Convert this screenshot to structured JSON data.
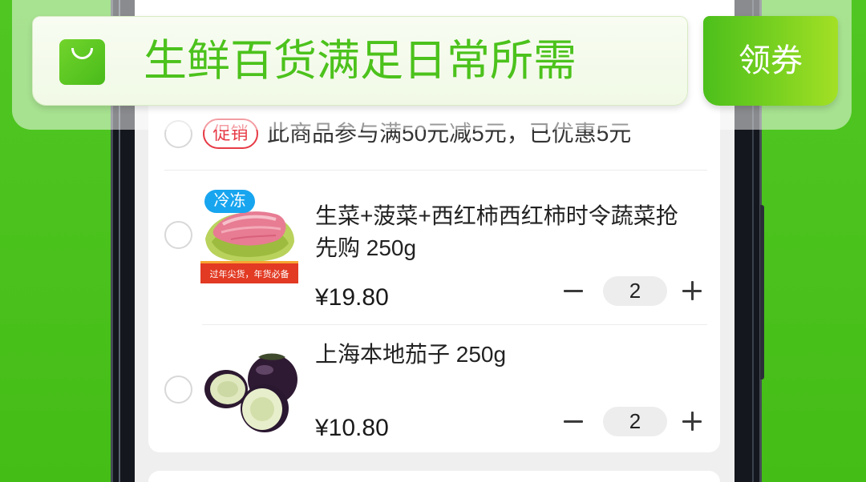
{
  "banner": {
    "icon": "shopping-bag-icon",
    "slogan": "生鲜百货满足日常所需",
    "coupon_label": "领券"
  },
  "cart": {
    "promo": {
      "tag": "促销",
      "text": "此商品参与满50元减5元，已优惠5元"
    },
    "items": [
      {
        "badge": "冷冻",
        "image_caption": "过年尖货，年货必备",
        "title": "生菜+菠菜+西红柿西红柿时令蔬菜抢先购 250g",
        "price": "¥19.80",
        "quantity": "2"
      },
      {
        "title": "上海本地茄子 250g",
        "price": "¥10.80",
        "quantity": "2"
      }
    ]
  },
  "icons": {
    "select": "radio-unchecked-icon",
    "decrease": "minus-icon",
    "increase": "plus-icon"
  },
  "theme": {
    "brand_green": "#4cc21c",
    "promo_red": "#e63b46",
    "cold_badge_blue": "#18a5ef",
    "coupon_gradient": [
      "#4cbf1b",
      "#a3e025"
    ]
  }
}
